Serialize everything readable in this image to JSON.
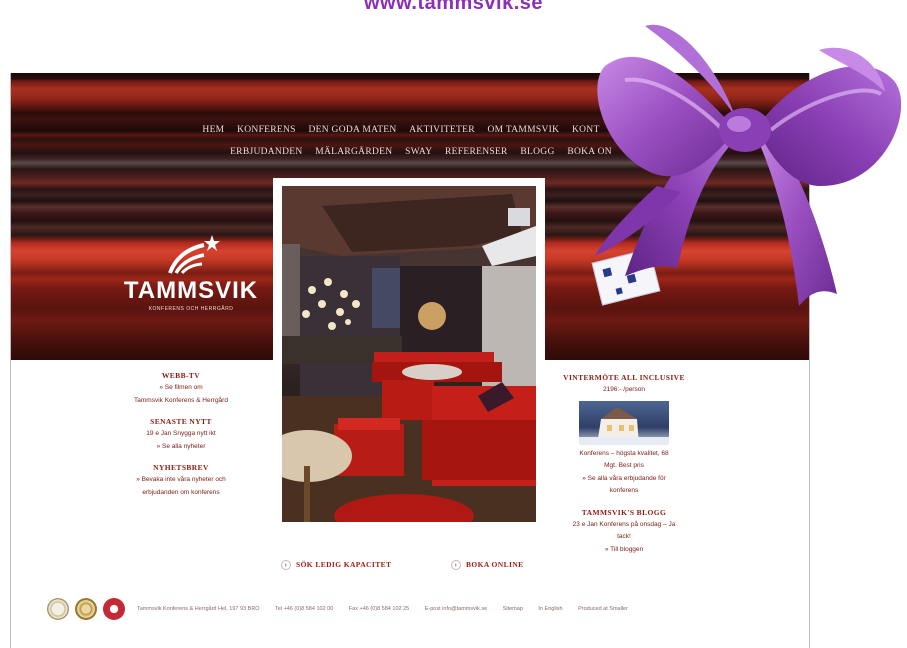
{
  "header_url": "www.tammsvik.se",
  "nav": {
    "row1": [
      "HEM",
      "KONFERENS",
      "DEN GODA MATEN",
      "AKTIVITETER",
      "OM TAMMSVIK",
      "KONT"
    ],
    "row2": [
      "ERBJUDANDEN",
      "MÄLARGÅRDEN",
      "SWAY",
      "REFERENSER",
      "BLOGG",
      "BOKA ON"
    ]
  },
  "logo": {
    "name": "TAMMSVIK",
    "tagline": "KONFERENS OCH HERRGÅRD"
  },
  "left_col": {
    "sections": [
      {
        "heading": "WEBB-TV",
        "lines": [
          "» Se filmen om",
          "Tammsvik Konferens & Herrgård"
        ]
      },
      {
        "heading": "SENASTE NYTT",
        "lines": [
          "19 e Jan Snygga nytt ikt",
          "» Se alla nyheter"
        ]
      },
      {
        "heading": "NYHETSBREV",
        "lines": [
          "» Bevaka inte våra nyheter och",
          "erbjudanden om konferens"
        ]
      }
    ]
  },
  "right_col": {
    "offer_heading": "VINTERMÖTE ALL INCLUSIVE",
    "offer_sub": "2196:- /person",
    "offer_lines": [
      "Konferens – högsta kvalitet, 68",
      "Mgt. Best pris",
      "» Se alla våra erbjudande för",
      "konferens"
    ],
    "blog_heading": "TAMMSVIK'S BLOGG",
    "blog_lines": [
      "23 e Jan Konferens på onsdag – Ja",
      "tack!",
      "» Till bloggen"
    ]
  },
  "ctas": {
    "capacity": "SÖK LEDIG KAPACITET",
    "book": "BOKA ONLINE"
  },
  "footer": {
    "items": [
      "Tammsvik Konferens & Herrgård Hel, 197 93 BRO",
      "Tel +46 (0)8 584 102 00",
      "Fax +46 (0)8 584 102 25",
      "E-post info@tammsvik.se",
      "Sitemap",
      "In English",
      "Produced at Smaller"
    ]
  },
  "colors": {
    "brand": "#8c1b12",
    "bow": "#9a4fc1",
    "url": "#8b2fb8"
  }
}
